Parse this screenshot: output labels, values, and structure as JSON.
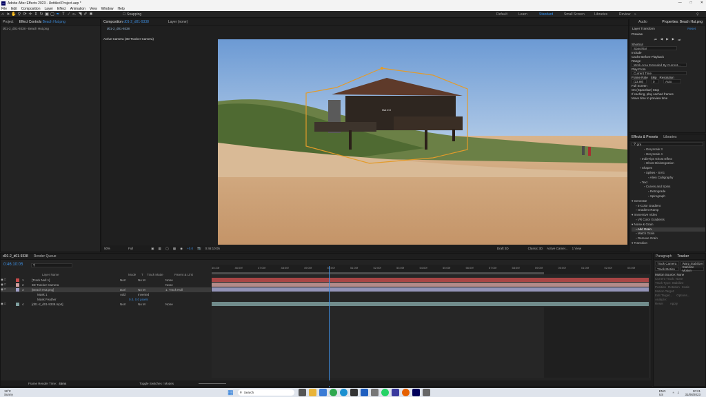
{
  "app": {
    "title": "Adobe After Effects 2023 - Untitled Project.aep *"
  },
  "menu": [
    "File",
    "Edit",
    "Composition",
    "Layer",
    "Effect",
    "Animation",
    "View",
    "Window",
    "Help"
  ],
  "toolbar": {
    "snapping": "Snapping",
    "workspaces": [
      "Default",
      "Learn",
      "Standard",
      "Small Screen",
      "Libraries",
      "Review"
    ],
    "active_workspace": "Standard"
  },
  "project_panel": {
    "tab": "Project",
    "effect_controls_tab": "Effect Controls",
    "effect_controls_target": "Beach Hut.png",
    "subtitle": "d01-2_d01-9338 - Beach Hut.png"
  },
  "composition_panel": {
    "tab": "Composition",
    "comp_name": "d01-2_d01-9338",
    "layer_tab": "Layer (none)",
    "subtab": "d01-2_d01-9338",
    "view_label": "Active Camera (3D Tracker Camera)",
    "zoom": "50%",
    "resolution": "Full",
    "exposure": "+0.0",
    "timecode": "0:46:10:05",
    "renderer": "Draft 3D",
    "renderer3d": "Classic 3D",
    "camera": "Active Camer...",
    "views": "1 View",
    "overlay_label": "Hut 2.0"
  },
  "properties": {
    "tabs": [
      "Audio",
      "Properties: Beach Hut.png"
    ],
    "sub_tabs": [
      "Layer Transform",
      "Reset"
    ],
    "preview": {
      "title": "Preview",
      "shortcut_label": "Shortcut",
      "shortcut": "Spacebar",
      "include_label": "Include",
      "cache": "Cache Before Playback",
      "range_label": "Range",
      "range": "Work Area Extended By Current...",
      "play_from_label": "Play From",
      "play_from": "Current Time",
      "frame_rate_label": "Frame Rate",
      "skip_label": "Skip",
      "resolution_label": "Resolution",
      "frame_rate": "(23.98)",
      "skip": "0",
      "resolution": "Auto",
      "full_screen": "Full Screen",
      "stop_label": "On (Spacebar) Stop",
      "stop_opt1": "If caching, play cached frames",
      "stop_opt2": "Move time to preview time"
    }
  },
  "effects": {
    "tabs": [
      "Effects & Presets",
      "Libraries"
    ],
    "search": "gra",
    "items": [
      {
        "label": "Greyscale 3",
        "indent": 3
      },
      {
        "label": "Greyscale 4",
        "indent": 3
      },
      {
        "label": "IndieTips Ghost Effect",
        "indent": 2
      },
      {
        "label": "Ghost Disintegration",
        "indent": 3
      },
      {
        "label": "Shapes",
        "indent": 2
      },
      {
        "label": "Spikes - SVG",
        "indent": 3
      },
      {
        "label": "Alien Calligraphy",
        "indent": 4
      },
      {
        "label": "Text",
        "indent": 2
      },
      {
        "label": "Curves and Spins",
        "indent": 3
      },
      {
        "label": "Retrograde",
        "indent": 4
      },
      {
        "label": "Spirograph",
        "indent": 4
      },
      {
        "label": "Generate",
        "indent": 0
      },
      {
        "label": "4-Color Gradient",
        "indent": 1
      },
      {
        "label": "Gradient Ramp",
        "indent": 1
      },
      {
        "label": "Immersive Video",
        "indent": 0
      },
      {
        "label": "VR Color Gradients",
        "indent": 1
      },
      {
        "label": "Noise & Grain",
        "indent": 0
      },
      {
        "label": "Add Grain",
        "indent": 1,
        "selected": true
      },
      {
        "label": "Match Grain",
        "indent": 1
      },
      {
        "label": "Remove Grain",
        "indent": 1
      },
      {
        "label": "Transition",
        "indent": 0
      }
    ]
  },
  "timeline": {
    "tab": "d01-2_d01-9338",
    "render_queue": "Render Queue",
    "timecode": "0:46:10:05",
    "columns": {
      "layer_name": "Layer Name",
      "mode": "Mode",
      "t": "T",
      "trkmat": "Track Matte",
      "parent": "Parent & Link"
    },
    "layers": [
      {
        "num": "1",
        "name": "[Track Null 1]",
        "mode": "Norr",
        "matte": "No M",
        "parent": "None",
        "color": "#c74a4a"
      },
      {
        "num": "2",
        "name": "3D Tracker Camera",
        "mode": "",
        "matte": "",
        "parent": "None",
        "color": "#d2a0a0"
      },
      {
        "num": "3",
        "name": "[Beach Hut.png]",
        "mode": "Darl",
        "matte": "No M",
        "parent": "1. Track Null",
        "color": "#a0a0c8"
      },
      {
        "num": "",
        "name": "Mask 1",
        "mode": "Add",
        "matte": "Inverted",
        "parent": "",
        "color": ""
      },
      {
        "num": "",
        "name": "Mask Feather",
        "mode": "",
        "matte": "",
        "parent": "",
        "color": ""
      },
      {
        "num": "4",
        "name": "[d01-2_d01-9338.mp4]",
        "mode": "Norr",
        "matte": "No M",
        "parent": "None",
        "color": "#7fa0a0"
      }
    ],
    "mask_feather_value": "0.0, 0.0 pixels",
    "ruler": [
      "45:23f",
      "46:00f",
      "47:00f",
      "48:00f",
      "49:00f",
      "50:00f",
      "51:00f",
      "52:00f",
      "53:00f",
      "54:00f",
      "55:00f",
      "56:00f",
      "57:00f",
      "58:00f",
      "59:00f",
      "00:00f",
      "01:00f",
      "02:00f",
      "03:00f"
    ],
    "frame_render_time_label": "Frame Render Time:",
    "frame_render_time": "45ms",
    "toggle": "Toggle Switches / Modes"
  },
  "paragraph_panel": {
    "tabs": [
      "Paragraph",
      "Tracker"
    ],
    "motion_source_label": "Motion Source:",
    "motion_source": "None",
    "current_track_label": "Current Track:",
    "current_track": "None",
    "track_type_label": "Track Type:",
    "track_type": "Stabilize",
    "buttons": [
      "Track Camera",
      "Warp Stabilizer",
      "Track Motion",
      "Stabilize Motion"
    ],
    "position": "Position",
    "rotation": "Rotation",
    "scale": "Scale",
    "motion_target": "Motion Target:",
    "edit_target": "Edit Target...",
    "options": "Options...",
    "analyze": "Analyze:",
    "reset": "Reset",
    "apply": "Apply"
  },
  "taskbar": {
    "weather_temp": "19°C",
    "weather_desc": "Sunny",
    "search": "Search",
    "lang": "ENG",
    "region": "US",
    "time": "20:21",
    "date": "31/08/2023"
  }
}
